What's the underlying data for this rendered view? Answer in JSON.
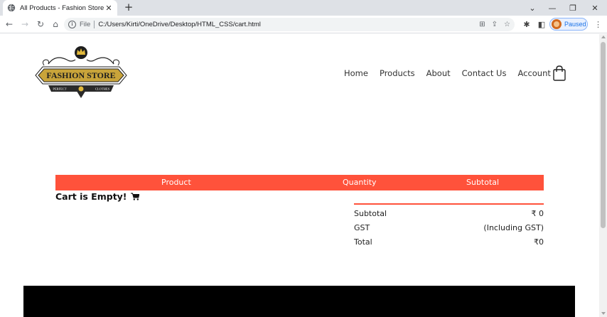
{
  "browser": {
    "tab_title": "All Products - Fashion Store",
    "tab_close": "✕",
    "new_tab": "+",
    "omnibox": {
      "file_label": "File",
      "url": "C:/Users/Kirti/OneDrive/Desktop/HTML_CSS/cart.html"
    },
    "profile_label": "Paused"
  },
  "logo": {
    "name": "FASHION STORE",
    "left_tag": "PERFECT",
    "right_tag": "CLOTHES"
  },
  "nav": {
    "items": [
      "Home",
      "Products",
      "About",
      "Contact Us",
      "Account"
    ]
  },
  "cart": {
    "columns": {
      "product": "Product",
      "quantity": "Quantity",
      "subtotal": "Subtotal"
    },
    "empty_message": "Cart is Empty!",
    "totals": [
      {
        "label": "Subtotal",
        "value": "₹ 0"
      },
      {
        "label": "GST",
        "value": "(Including GST)"
      },
      {
        "label": "Total",
        "value": "₹0"
      }
    ]
  },
  "colors": {
    "accent": "#ff523b",
    "logo_gold": "#c9a43a",
    "footer": "#000000"
  }
}
